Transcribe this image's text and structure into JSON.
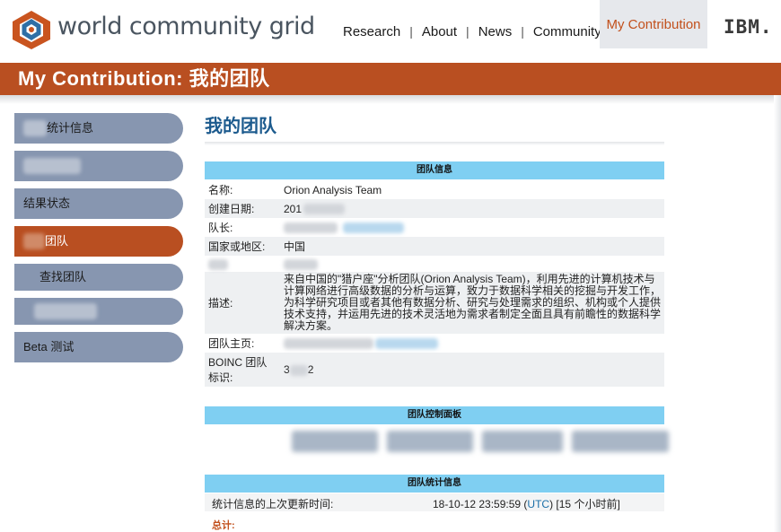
{
  "header": {
    "logo_text": "world community grid",
    "nav": [
      "Research",
      "About",
      "News",
      "Community"
    ],
    "nav_active": "My Contribution",
    "ibm": "IBM."
  },
  "titlebar": "My Contribution:  我的团队",
  "sidebar": {
    "items": [
      {
        "label": "统计信息"
      },
      {
        "label": ""
      },
      {
        "label": "结果状态"
      },
      {
        "label": "团队",
        "active": true
      }
    ],
    "sub_items": [
      {
        "label": "查找团队"
      },
      {
        "label": ""
      }
    ],
    "beta": "Beta 测试"
  },
  "main": {
    "page_title": "我的团队",
    "team_info_header": "团队信息",
    "fields": {
      "name_label": "名称:",
      "name_value": "Orion Analysis Team",
      "date_label": "创建日期:",
      "date_value": "201",
      "captain_label": "队长:",
      "region_label": "国家或地区:",
      "region_value": "中国",
      "desc_label": "描述:",
      "desc_value": "来自中国的\"猎户座\"分析团队(Orion Analysis Team)，利用先进的计算机技术与计算网络进行高级数据的分析与运算，致力于数据科学相关的挖掘与开发工作，为科学研究项目或者其他有数据分析、研究与处理需求的组织、机构或个人提供技术支持，并运用先进的技术灵活地为需求者制定全面且具有前瞻性的数据科学解决方案。",
      "homepage_label": "团队主页:",
      "boinc_label": "BOINC 团队标识:",
      "boinc_value": "3",
      "boinc_value_tail": "2"
    },
    "control_header": "团队控制面板",
    "stats_header": "团队统计信息",
    "stats_label": "统计信息的上次更新时间:",
    "stats_value_date": "18-10-12 23:59:59 (",
    "stats_value_utc": "UTC",
    "stats_value_tail": ") [15 个小时前]",
    "total_label": "总计:"
  },
  "colors": {
    "brand_orange": "#b94f21",
    "sidebar_blue": "#8796b0",
    "section_blue": "#7fcff2",
    "title_blue": "#1d5b8e"
  }
}
